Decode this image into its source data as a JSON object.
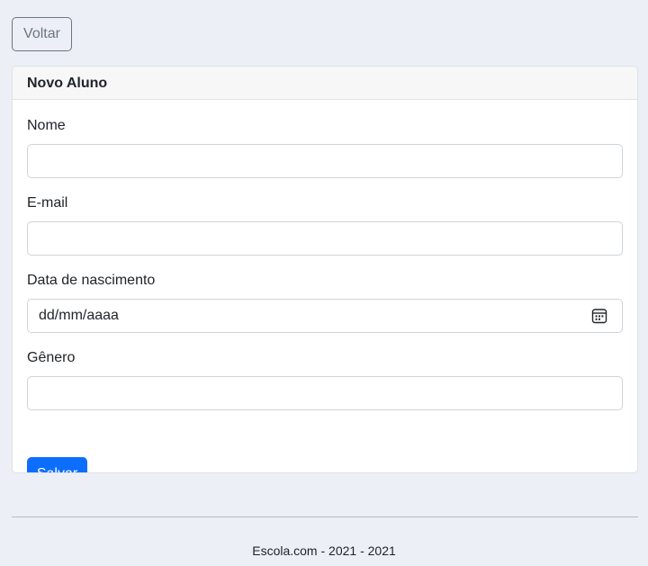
{
  "toolbar": {
    "back_label": "Voltar"
  },
  "card": {
    "title": "Novo Aluno"
  },
  "form": {
    "name": {
      "label": "Nome",
      "value": ""
    },
    "email": {
      "label": "E-mail",
      "value": ""
    },
    "birthdate": {
      "label": "Data de nascimento",
      "placeholder": "dd/mm/aaaa",
      "icon": "calendar-icon"
    },
    "gender": {
      "label": "Gênero",
      "value": ""
    },
    "save_label": "Salvar"
  },
  "footer": {
    "text": "Escola.com - 2021 - 2021"
  },
  "colors": {
    "background": "#eceff6",
    "primary": "#0d6efd",
    "secondary": "#6c757d"
  }
}
